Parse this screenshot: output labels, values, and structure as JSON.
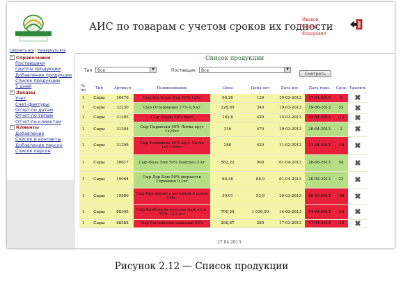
{
  "header": {
    "title": "АИС по товарам с учетом сроков их годности",
    "logo_text": "СЕЛЕКОМ КОНТИНЕНТ",
    "user_name": [
      "Иванов",
      "Сергей",
      "Федорович"
    ]
  },
  "sidebar": {
    "collapse_all": "Свернуть все",
    "separator": " | ",
    "expand_all": "Развернуть все",
    "sections": [
      {
        "title": "Справочники",
        "items": [
          "Поставщики",
          "Группы продукции",
          "Добавление продукции",
          "Список продукции",
          "5 дней"
        ]
      },
      {
        "title": "Заказы",
        "items": [
          "Учет",
          "Счет-фактуры",
          "Отчет по датам",
          "Отчет по типам",
          "Отчет по клиентам"
        ]
      },
      {
        "title": "Клиенты",
        "items": [
          "Добавление",
          "Список и контакты",
          "Добавление персон",
          "Список персон"
        ]
      }
    ]
  },
  "main": {
    "title": "Список продукции",
    "filters": {
      "type_label": "Тип",
      "type_value": "Все",
      "supplier_label": "Поставщик",
      "supplier_value": "Все",
      "view_button": "Смотреть"
    },
    "columns": [
      "№ пп",
      "Тип",
      "Артикул",
      "Наименование",
      "Цена",
      "Цена опт",
      "Дата изг.",
      "Дата годн.",
      "Срок",
      "Удалить"
    ],
    "rows": [
      {
        "n": "1",
        "type": "Сыры",
        "article": "16476",
        "name": "Сыр Кастелло Бри 50% 125г",
        "price": "90,26",
        "price_opt": "139",
        "date_made": "19-03-2013",
        "date_exp": "27-04-2013",
        "term": "0",
        "status": "red"
      },
      {
        "n": "1",
        "type": "Сыры",
        "article": "32230",
        "name": "Сыр Оттерманни 17% 0,9 кг",
        "price": "228,69",
        "price_opt": "340",
        "date_made": "19-03-2013",
        "date_exp": "19-06-2013",
        "term": "53",
        "status": "green"
      },
      {
        "n": "1",
        "type": "Сыры",
        "article": "31305",
        "name": "Сыр Дзаро 50% брус",
        "price": "262,6",
        "price_opt": "420",
        "date_made": "15-03-2013",
        "date_exp": "15-04-2013",
        "term": "-12",
        "status": "red"
      },
      {
        "n": "1",
        "type": "Сыры",
        "article": "31304",
        "name": "Сыр Пармезан 40% Литва круг 1x25кг",
        "price": "316",
        "price_opt": "470",
        "date_made": "19-03-2013",
        "date_exp": "30-04-2013",
        "term": "3",
        "status": "green"
      },
      {
        "n": "1",
        "type": "Сыры",
        "article": "31298",
        "name": "Сыр Рокишкио 50% круг Литва 1x13.50кг.",
        "price": "280",
        "price_opt": "420",
        "date_made": "11-02-2013",
        "date_exp": "11-04-2013",
        "term": "-16",
        "status": "red"
      },
      {
        "n": "1",
        "type": "Сыры",
        "article": "30617",
        "price": "562,22",
        "name": "Сыр Фоль Эпи 50% Бонгрен 3 кг",
        "price_opt": "900",
        "date_made": "01-04-2013",
        "date_exp": "20-06-2013",
        "term": "54",
        "status": "green"
      },
      {
        "n": "1",
        "type": "Сыры",
        "article": "19964",
        "name": "Сыр Дор Блю 50% жирности Германия 0,1кг",
        "price": "60,38",
        "price_opt": "88,9",
        "date_made": "01-04-2013",
        "date_exp": "20-05-2013",
        "term": "23",
        "status": "green"
      },
      {
        "n": "1",
        "type": "Сыры",
        "article": "19500",
        "name": "Сыр Президент с ветчиной 8 долек 140г.",
        "price": "30,01",
        "price_opt": "53,9",
        "date_made": "20-03-2013",
        "date_exp": "20-03-2013",
        "term": "-38",
        "status": "red"
      },
      {
        "n": "1",
        "type": "Сыры",
        "article": "68305",
        "name": "Сыр Камбоцола классик мдж в с.в. 70%, (2,2 кг)",
        "price": "700,54",
        "price_opt": "1 030,00",
        "date_made": "14-03-2013",
        "date_exp": "14-04-2013",
        "term": "-13",
        "status": "red"
      },
      {
        "n": "1",
        "type": "Сыры",
        "article": "68585",
        "name": "Сыр Российский заказной 50%",
        "price": "206,67",
        "price_opt": "280",
        "date_made": "17-03-2013",
        "date_exp": "17-04-2013",
        "term": "-10",
        "status": "red"
      }
    ],
    "footer_date": "27.04.2013"
  },
  "caption": "Рисунок 2.12 — Список продукции",
  "colors": {
    "red": "#e8203a",
    "green": "#b6de86",
    "yellow": "#f4f5a8",
    "link": "#1a2a90",
    "section": "#a01818"
  },
  "icons": {
    "logo": "company-logo",
    "exit": "exit-door-icon",
    "delete": "delete-x-icon"
  }
}
